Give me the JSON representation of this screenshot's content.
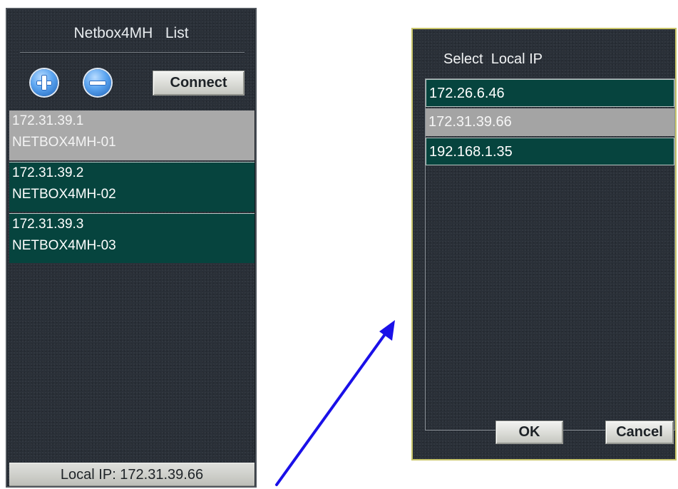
{
  "left_panel": {
    "title": "Netbox4MH   List",
    "add_icon": "plus-circle-icon",
    "remove_icon": "minus-circle-icon",
    "connect_label": "Connect",
    "devices": [
      {
        "ip": "172.31.39.1",
        "name": "NETBOX4MH-01",
        "selected": true
      },
      {
        "ip": "172.31.39.2",
        "name": "NETBOX4MH-02",
        "selected": false
      },
      {
        "ip": "172.31.39.3",
        "name": "NETBOX4MH-03",
        "selected": false
      }
    ],
    "local_ip_label": "Local IP: 172.31.39.66"
  },
  "arrow": {
    "icon": "arrow-icon",
    "color": "#1a10e8"
  },
  "dialog": {
    "title": "Select  Local IP",
    "local_ips": [
      {
        "ip": "172.26.6.46",
        "selected": false
      },
      {
        "ip": "172.31.39.66",
        "selected": true
      },
      {
        "ip": "192.168.1.35",
        "selected": false
      }
    ],
    "ok_label": "OK",
    "cancel_label": "Cancel",
    "border_color": "#c9c56a"
  },
  "colors": {
    "panel_bg": "#2a3038",
    "item_bg": "#06443e",
    "selected_bg": "#a9a9a9"
  }
}
